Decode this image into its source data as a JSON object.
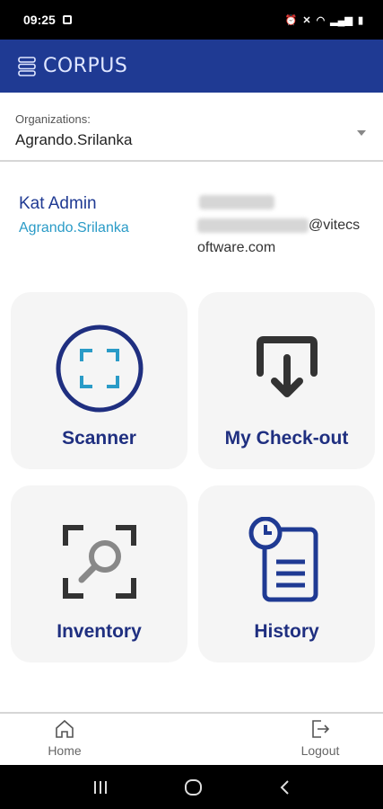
{
  "status_bar": {
    "time": "09:25"
  },
  "app": {
    "title": "CORPUS"
  },
  "organization": {
    "label": "Organizations:",
    "value": "Agrando.Srilanka"
  },
  "user": {
    "name": "Kat Admin",
    "org": "Agrando.Srilanka",
    "email_tail": "@vitecs",
    "email_tail2": "oftware.com"
  },
  "tiles": [
    {
      "label": "Scanner",
      "icon": "scan-icon"
    },
    {
      "label": "My Check-out",
      "icon": "download-tray-icon"
    },
    {
      "label": "Inventory",
      "icon": "magnifier-frame-icon"
    },
    {
      "label": "History",
      "icon": "clock-document-icon"
    }
  ],
  "nav": {
    "home": "Home",
    "logout": "Logout"
  },
  "colors": {
    "brand": "#1f3a93",
    "tile_label": "#1f2f80",
    "accent": "#2a9bc7"
  }
}
